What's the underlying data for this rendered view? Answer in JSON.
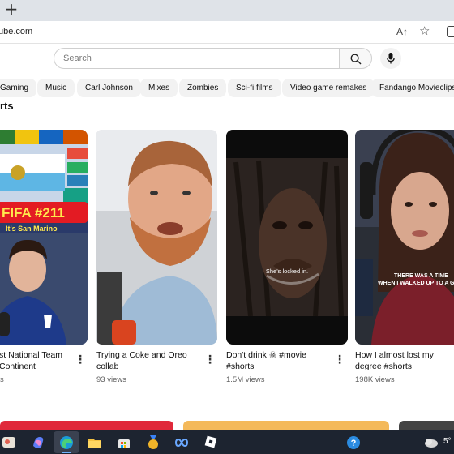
{
  "browser": {
    "new_tab_glyph": "+",
    "url": "ube.com",
    "read_aloud": "A↑",
    "favorite_glyph": "☆"
  },
  "search": {
    "placeholder": "Search"
  },
  "chips": [
    "Gaming",
    "Music",
    "Carl Johnson",
    "Mixes",
    "Zombies",
    "Sci-fi films",
    "Video game remakes",
    "Fandango Movieclips"
  ],
  "section": {
    "title": "orts"
  },
  "shorts": [
    {
      "title_line1": "st National Team",
      "title_line2": "Continent",
      "views": "s",
      "overlay": "FIFA #211",
      "overlay2": "It's San Marino"
    },
    {
      "title_line1": "Trying a Coke and Oreo",
      "title_line2": "collab",
      "views": "93 views"
    },
    {
      "title_line1": "Don't drink ☠ #movie",
      "title_line2": "#shorts",
      "views": "1.5M views",
      "caption": "She's locked in."
    },
    {
      "title_line1": "How I almost lost my",
      "title_line2": "degree #shorts",
      "views": "198K views",
      "caption": "THERE WAS A TIME\nWHEN I WALKED UP TO A GI"
    }
  ],
  "taskbar": {
    "temperature": "5°",
    "help_glyph": "?"
  },
  "colors": {
    "accent": "#ff0000",
    "taskbar": "#1d2430",
    "chip": "#f2f2f2"
  }
}
